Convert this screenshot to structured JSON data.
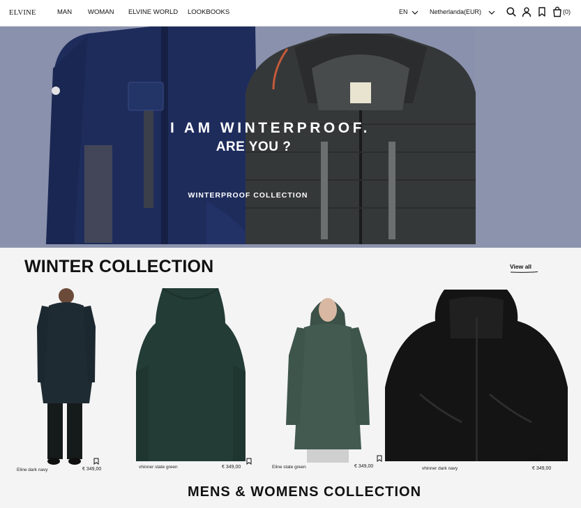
{
  "header": {
    "logo": "ELVINE",
    "nav": [
      "MAN",
      "WOMAN",
      "ELVINE WORLD",
      "LOOKBOOKS"
    ],
    "language": "EN",
    "region": "Netherlanda(EUR)",
    "cart_count": "(0)"
  },
  "hero": {
    "headline": "I AM WINTERPROOF.",
    "subheadline": "ARE YOU ?",
    "cta": "WINTERPROOF COLLECTION"
  },
  "winter": {
    "title": "WINTER COLLECTION",
    "view_all": "View all",
    "products": [
      {
        "name": "Eline dark navy",
        "price": "€ 349,00"
      },
      {
        "name": "vhinner state green",
        "price": "€ 349,00"
      },
      {
        "name": "Eline state green",
        "price": "€ 349,00"
      },
      {
        "name": "vhinner dark navy",
        "price": "€ 349,00"
      }
    ]
  },
  "next_section": {
    "title": "MENS & WOMENS COLLECTION"
  }
}
